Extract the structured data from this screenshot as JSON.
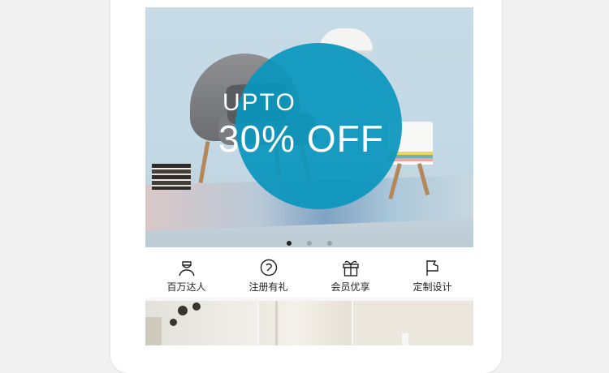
{
  "banner": {
    "line1": "UPTO",
    "line2": "30% OFF",
    "slides": 3,
    "active_slide": 1
  },
  "menu": {
    "items": [
      {
        "label": "百万达人",
        "icon": "expert-icon"
      },
      {
        "label": "注册有礼",
        "icon": "register-icon"
      },
      {
        "label": "会员优享",
        "icon": "gift-icon"
      },
      {
        "label": "定制设计",
        "icon": "flag-icon"
      }
    ]
  },
  "colors": {
    "promo_circle": "#0a96bd",
    "dot_active": "#222222",
    "dot_inactive": "#9aa3a8"
  }
}
